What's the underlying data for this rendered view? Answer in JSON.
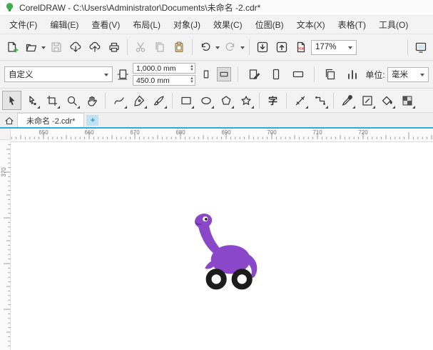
{
  "titlebar": {
    "title": "CorelDRAW - C:\\Users\\Administrator\\Documents\\未命名 -2.cdr*"
  },
  "menubar": {
    "items": [
      "文件(F)",
      "编辑(E)",
      "查看(V)",
      "布局(L)",
      "对象(J)",
      "效果(C)",
      "位图(B)",
      "文本(X)",
      "表格(T)",
      "工具(O)"
    ]
  },
  "toolbar": {
    "icons": [
      "new-document",
      "open",
      "save",
      "open-from-cloud",
      "save-to-cloud",
      "print",
      "cut",
      "copy",
      "paste",
      "undo",
      "redo",
      "import",
      "export",
      "publish-pdf",
      "zoom-level",
      "full-screen-preview"
    ],
    "zoom_value": "177%",
    "pdf_label": "PDF"
  },
  "property_bar": {
    "preset": "自定义",
    "width_value": "1,000.0 mm",
    "height_value": "450.0 mm",
    "units_label": "单位:",
    "units_value": "毫米"
  },
  "toolbox": {
    "text_glyph": "字",
    "tools": [
      "pick",
      "shape",
      "crop",
      "zoom",
      "pan",
      "freehand",
      "pen",
      "artistic-media",
      "rectangle",
      "ellipse",
      "polygon",
      "star",
      "text",
      "parallel-dimension",
      "connector",
      "eyedropper",
      "outline",
      "interactive-fill",
      "transparency"
    ],
    "selected_tool": "pick"
  },
  "document_tabs": {
    "active_label": "未命名 -2.cdr*",
    "new_tab_label": "+"
  },
  "rulers": {
    "h_labels": [
      "650",
      "660",
      "670",
      "680",
      "690",
      "700",
      "710",
      "720"
    ],
    "v_labels": [
      "370"
    ],
    "h_start": 46,
    "v_start": 42,
    "spacing": 64
  },
  "canvas": {
    "object": "dinosaur-on-wheels",
    "colors": {
      "body": "#8a47c9",
      "wheel": "#1c1c1c",
      "eye_white": "#ffffff",
      "pupil": "#1c1c1c",
      "mouth": "#5c2d8f"
    }
  }
}
